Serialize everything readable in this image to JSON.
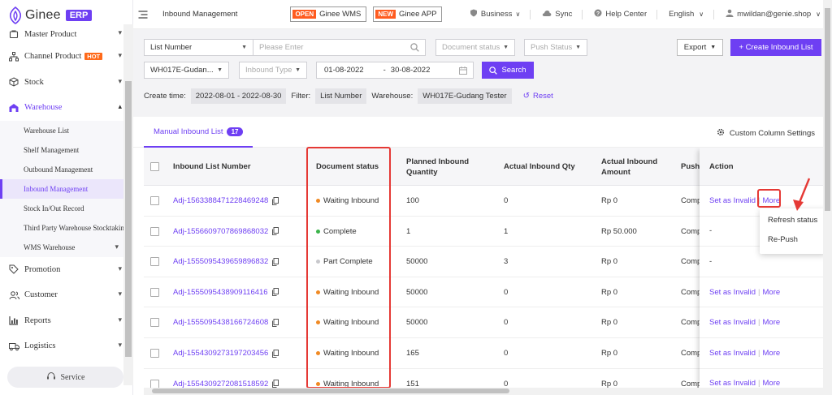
{
  "brand": {
    "name": "Ginee",
    "badge": "ERP"
  },
  "colors": {
    "accent": "#6e3ff3",
    "hot": "#ff6a1a",
    "annotation": "#e53935"
  },
  "sidebar": {
    "items": [
      {
        "label": "Master Product",
        "icon": "product-icon"
      },
      {
        "label": "Channel Product",
        "icon": "channel-icon",
        "badge": "HOT"
      },
      {
        "label": "Stock",
        "icon": "stock-icon"
      },
      {
        "label": "Warehouse",
        "icon": "warehouse-icon"
      }
    ],
    "warehouse_sub": [
      "Warehouse List",
      "Shelf Management",
      "Outbound Management",
      "Inbound Management",
      "Stock In/Out Record",
      "Third Party Warehouse Stocktaking",
      "WMS Warehouse"
    ],
    "more_items": [
      {
        "label": "Promotion",
        "icon": "promotion-icon"
      },
      {
        "label": "Customer",
        "icon": "customer-icon"
      },
      {
        "label": "Reports",
        "icon": "reports-icon"
      },
      {
        "label": "Logistics",
        "icon": "logistics-icon"
      }
    ],
    "service_label": "Service"
  },
  "header": {
    "page_name": "Inbound Management",
    "wms_tag": "OPEN",
    "wms_label": "Ginee WMS",
    "app_tag": "NEW",
    "app_label": "Ginee APP",
    "business": "Business",
    "sync": "Sync",
    "help": "Help Center",
    "language": "English",
    "user": "mwildan@genie.shop"
  },
  "filters": {
    "search_type": "List Number",
    "search_placeholder": "Please Enter",
    "doc_status_placeholder": "Document status",
    "push_status_placeholder": "Push Status",
    "export_label": "Export",
    "create_label": "+ Create Inbound List",
    "warehouse_value": "WH017E-Gudan...",
    "inbound_type_placeholder": "Inbound Type",
    "date_from": "01-08-2022",
    "date_sep": "-",
    "date_to": "30-08-2022",
    "search_label": "Search",
    "create_time_label": "Create time:",
    "create_time_value": "2022-08-01 - 2022-08-30",
    "filter_label": "Filter:",
    "filter_value": "List Number",
    "warehouse_label": "Warehouse:",
    "warehouse_chip": "WH017E-Gudang Tester",
    "reset_label": "Reset"
  },
  "tabs": {
    "manual_label": "Manual Inbound List",
    "manual_count": "17",
    "col_settings": "Custom Column Settings"
  },
  "table": {
    "headers": {
      "number": "Inbound List Number",
      "status": "Document status",
      "planned": "Planned Inbound Quantity",
      "actual_qty": "Actual Inbound Qty",
      "actual_amount": "Actual Inbound Amount",
      "push": "Push",
      "action": "Action"
    },
    "rows": [
      {
        "number": "Adj-1563388471228469248",
        "status": "Waiting Inbound",
        "status_color": "#f08a24",
        "planned": "100",
        "actual_qty": "0",
        "amount": "Rp 0",
        "push": "Comp",
        "act1": "Set as Invalid",
        "act2": "More"
      },
      {
        "number": "Adj-1556609707869868032",
        "status": "Complete",
        "status_color": "#3cb44b",
        "planned": "1",
        "actual_qty": "1",
        "amount": "Rp 50.000",
        "push": "Comp",
        "act1": "-",
        "act2": ""
      },
      {
        "number": "Adj-1555095439659896832",
        "status": "Part Complete",
        "status_color": "#c8c8cc",
        "planned": "50000",
        "actual_qty": "3",
        "amount": "Rp 0",
        "push": "Comp",
        "act1": "-",
        "act2": ""
      },
      {
        "number": "Adj-1555095438909116416",
        "status": "Waiting Inbound",
        "status_color": "#f08a24",
        "planned": "50000",
        "actual_qty": "0",
        "amount": "Rp 0",
        "push": "Comp",
        "act1": "Set as Invalid",
        "act2": "More"
      },
      {
        "number": "Adj-1555095438166724608",
        "status": "Waiting Inbound",
        "status_color": "#f08a24",
        "planned": "50000",
        "actual_qty": "0",
        "amount": "Rp 0",
        "push": "Comp",
        "act1": "Set as Invalid",
        "act2": "More"
      },
      {
        "number": "Adj-1554309273197203456",
        "status": "Waiting Inbound",
        "status_color": "#f08a24",
        "planned": "165",
        "actual_qty": "0",
        "amount": "Rp 0",
        "push": "Comp",
        "act1": "Set as Invalid",
        "act2": "More"
      },
      {
        "number": "Adj-1554309272081518592",
        "status": "Waiting Inbound",
        "status_color": "#f08a24",
        "planned": "151",
        "actual_qty": "0",
        "amount": "Rp 0",
        "push": "Comp",
        "act1": "Set as Invalid",
        "act2": "More"
      }
    ]
  },
  "more_menu": {
    "refresh": "Refresh status",
    "repush": "Re-Push"
  }
}
